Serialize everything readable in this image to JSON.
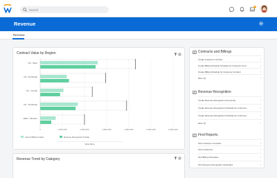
{
  "topbar": {
    "search_placeholder": "Search",
    "notification_count": "3"
  },
  "page": {
    "title": "Revenue",
    "tab": "Revenue"
  },
  "chart_card": {
    "title": "Contract Value by Region",
    "view_more": "View More"
  },
  "chart_data": {
    "type": "bar",
    "title": "Contract Value by Region",
    "orientation": "horizontal",
    "categories": [
      "US - West",
      "US - Northeast",
      "US - Central",
      "UK - Northeast",
      "EMA - Western"
    ],
    "series": [
      {
        "name": "Amount Billed to Date",
        "color": "#a8e6cf",
        "values": [
          2600000,
          1200000,
          1050000,
          1700000,
          700000
        ]
      },
      {
        "name": "Revenue Recognized To Date",
        "color": "#5fcf9f",
        "values": [
          2500000,
          1300000,
          900000,
          1600000,
          500000
        ]
      }
    ],
    "totals": [
      4300000,
      2950000,
      2350000,
      3900000,
      2000000
    ],
    "xticks": [
      "0",
      "1,000,000",
      "2,000,000",
      "3,000,000",
      "4,000,000",
      "5,000,000",
      "6,000,000"
    ],
    "xlim": [
      0,
      6000000
    ],
    "legend": "bottom-left"
  },
  "trend_card": {
    "title": "Revenue Trend by Category"
  },
  "sections": [
    {
      "title": "Contracts and Billings",
      "items": [
        "Create Customer Contract",
        "Create Billing Schedule Template for Customer Cont...",
        "Create Billing Schedule for Customer Contract",
        "More (2)"
      ]
    },
    {
      "title": "Revenue Recognition",
      "items": [
        "Create Revenue Recognition Accounting",
        "Create Revenue Recognition Schedule for Customer...",
        "Create Revenue Recognition Schedule for Customer...",
        "More (4)"
      ]
    },
    {
      "title": "Find Reports",
      "items": [
        "Find Customer Contracts",
        "Find Customers",
        "Find Billing Schedules",
        "Find Revenue Recognition Schedules"
      ]
    }
  ],
  "colors": {
    "brand_blue": "#0a6bd6",
    "bar_light": "#a8e6cf",
    "bar_dark": "#5fcf9f",
    "badge": "#f5a623"
  },
  "icons": [
    "workday-logo-icon",
    "search-icon",
    "chat-icon",
    "bell-icon",
    "inbox-icon",
    "avatar",
    "gear-icon",
    "filter-icon",
    "settings-icon",
    "list-section-icon",
    "chevron-right-icon"
  ]
}
